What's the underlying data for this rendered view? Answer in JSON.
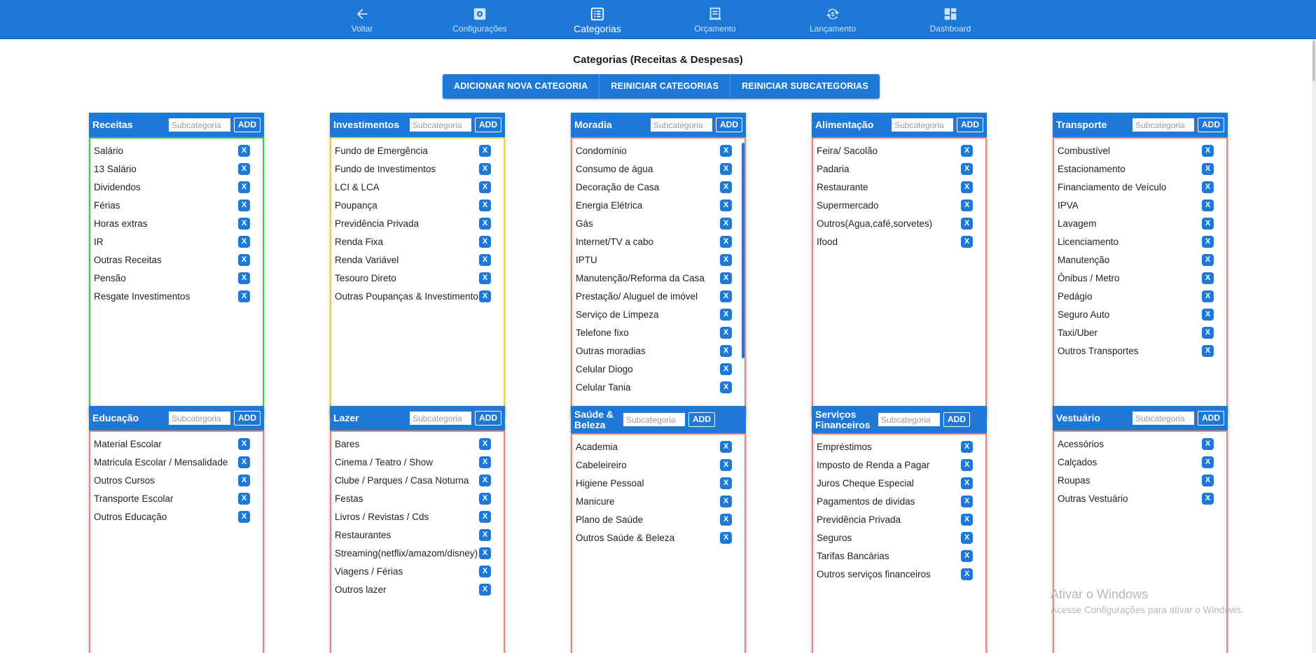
{
  "nav": {
    "voltar": "Voltar",
    "configuracoes": "Configurações",
    "categorias": "Categorias",
    "orcamento": "Orçamento",
    "lancamento": "Lançamento",
    "dashboard": "Dashboard"
  },
  "page": {
    "title": "Categorias (Receitas & Despesas)"
  },
  "actions": {
    "add_category": "ADICIONAR NOVA CATEGORIA",
    "reset_categories": "REINICIAR CATEGORIAS",
    "reset_subcategories": "REINICIAR SUBCATEGORIAS"
  },
  "common": {
    "placeholder": "Subcategoria",
    "add_label": "ADD",
    "remove_label": "X"
  },
  "colors": {
    "accent": "#1e78d7",
    "income_border": "#3ccf3c",
    "investment_border": "#dcdc22",
    "expense_border": "#f08070"
  },
  "categories": [
    {
      "name": "Receitas",
      "items": [
        "Salário",
        "13 Salário",
        "Dividendos",
        "Férias",
        "Horas extras",
        "IR",
        "Outras Receitas",
        "Pensão",
        "Resgate Investimentos"
      ]
    },
    {
      "name": "Investimentos",
      "items": [
        "Fundo de Emergência",
        "Fundo de Investimentos",
        "LCI & LCA",
        "Poupança",
        "Previdência Privada",
        "Renda Fixa",
        "Renda Variável",
        "Tesouro Direto",
        "Outras Poupanças & Investimento"
      ]
    },
    {
      "name": "Moradia",
      "items": [
        "Condomínio",
        "Consumo de água",
        "Decoração de Casa",
        "Energia Elétrica",
        "Gás",
        "Internet/TV a cabo",
        "IPTU",
        "Manutenção/Reforma da Casa",
        "Prestação/ Aluguel de imóvel",
        "Serviço de Limpeza",
        "Telefone fixo",
        "Outras moradias",
        "Celular Diogo",
        "Celular Tania"
      ]
    },
    {
      "name": "Alimentação",
      "items": [
        "Feira/ Sacolão",
        "Padaria",
        "Restaurante",
        "Supermercado",
        "Outros(Agua,café,sorvetes)",
        "Ifood"
      ]
    },
    {
      "name": "Transporte",
      "items": [
        "Combustível",
        "Estacionamento",
        "Financiamento de Veículo",
        "IPVA",
        "Lavagem",
        "Licenciamento",
        "Manutenção",
        "Ônibus / Metro",
        "Pedágio",
        "Seguro Auto",
        "Taxi/Uber",
        "Outros Transportes"
      ]
    },
    {
      "name": "Educação",
      "items": [
        "Material Escolar",
        "Matricula Escolar / Mensalidade",
        "Outros Cursos",
        "Transporte Escolar",
        "Outros Educação"
      ]
    },
    {
      "name": "Lazer",
      "items": [
        "Bares",
        "Cinema / Teatro / Show",
        "Clube / Parques / Casa Noturna",
        "Festas",
        "Livros / Revistas / Cds",
        "Restaurantes",
        "Streaming(netflix/amazom/disney)",
        "Viagens / Férias",
        "Outros lazer"
      ]
    },
    {
      "name": "Saúde & Beleza",
      "items": [
        "Academia",
        "Cabeleireiro",
        "Higiene Pessoal",
        "Manicure",
        "Plano de Saúde",
        "Outros Saúde & Beleza"
      ]
    },
    {
      "name": "Serviços Financeiros",
      "items": [
        "Empréstimos",
        "Imposto de Renda a Pagar",
        "Juros Cheque Especial",
        "Pagamentos de dividas",
        "Previdência Privada",
        "Seguros",
        "Tarifas Bancárias",
        "Outros serviços financeiros"
      ]
    },
    {
      "name": "Vestuário",
      "items": [
        "Acessórios",
        "Calçados",
        "Roupas",
        "Outras Vestuário"
      ]
    }
  ],
  "watermark": {
    "line1": "Ativar o Windows",
    "line2": "Acesse Configurações para ativar o Windows."
  }
}
